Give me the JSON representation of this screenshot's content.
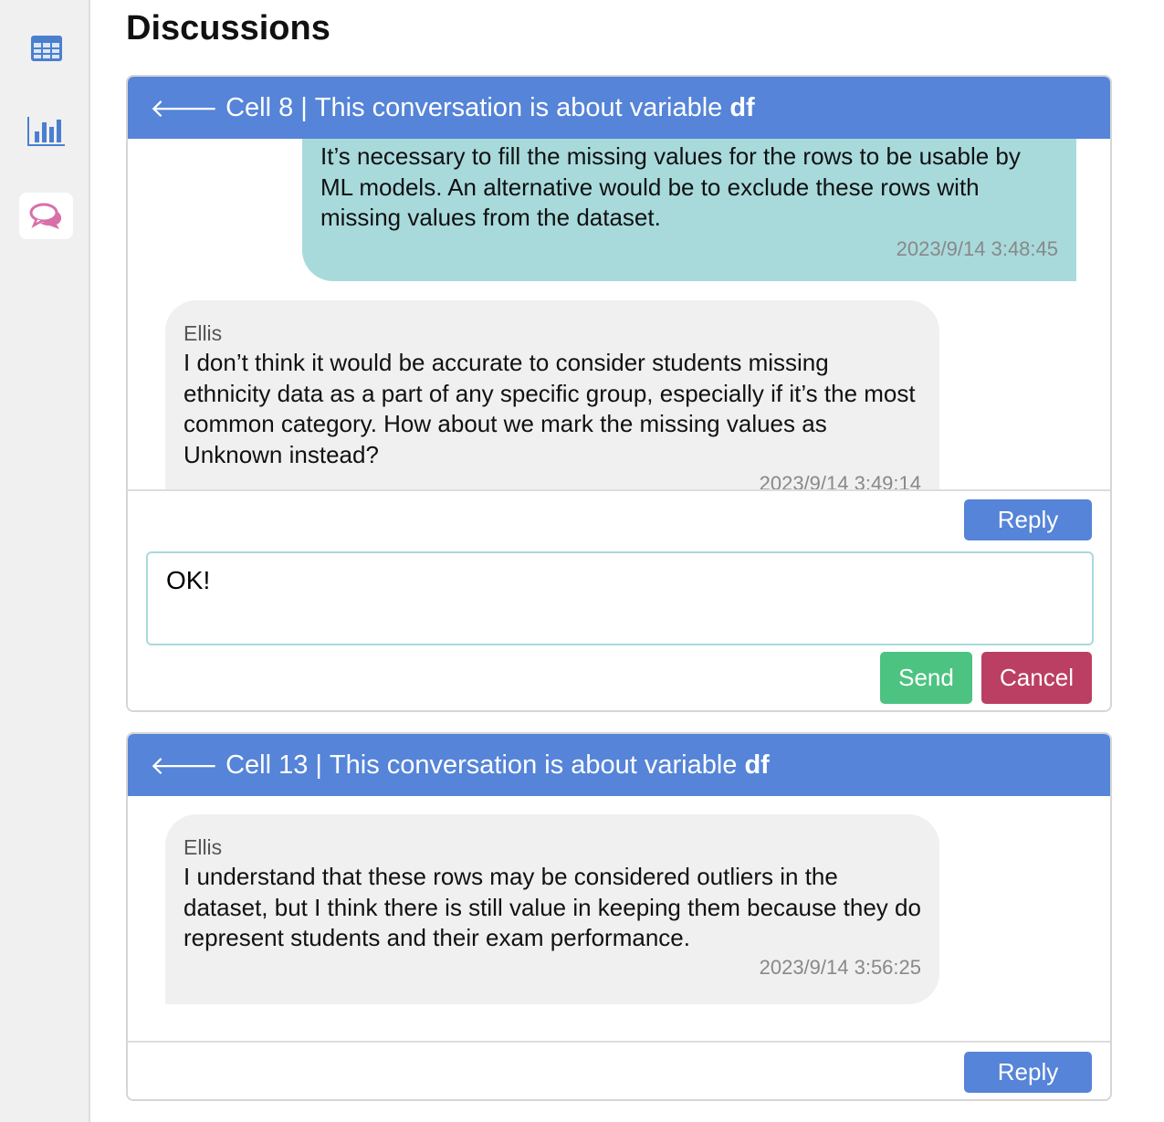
{
  "sidebar": {
    "items": [
      {
        "icon": "table-icon"
      },
      {
        "icon": "bar-chart-icon"
      },
      {
        "icon": "comments-icon",
        "active": true
      }
    ]
  },
  "page_title": "Discussions",
  "threads": [
    {
      "cell": "Cell 8",
      "about": "This conversation is about variable",
      "variable": "df",
      "messages": [
        {
          "mine": true,
          "text": "It’s necessary to fill the missing values for the rows to be usable by ML models. An alternative would be to exclude these rows with missing values from the dataset.",
          "time": "2023/9/14 3:48:45"
        },
        {
          "author": "Ellis",
          "text": "I don’t think it would be accurate to consider students missing ethnicity data as a part of any specific group, especially if it’s the most common category. How about we mark the missing values as Unknown instead?",
          "time": "2023/9/14 3:49:14"
        }
      ],
      "reply_label": "Reply",
      "input_value": "OK!",
      "send_label": "Send",
      "cancel_label": "Cancel"
    },
    {
      "cell": "Cell 13",
      "about": "This conversation is about variable",
      "variable": "df",
      "messages": [
        {
          "author": "Ellis",
          "text": "I understand that these rows may be considered outliers in the dataset, but I think there is still value in keeping them because they do represent students and their exam performance.",
          "time": "2023/9/14 3:56:25"
        }
      ],
      "reply_label": "Reply"
    }
  ],
  "colors": {
    "header": "#5584d8",
    "mine": "#a8dadc",
    "send": "#4cc381",
    "cancel": "#bb3f63"
  }
}
